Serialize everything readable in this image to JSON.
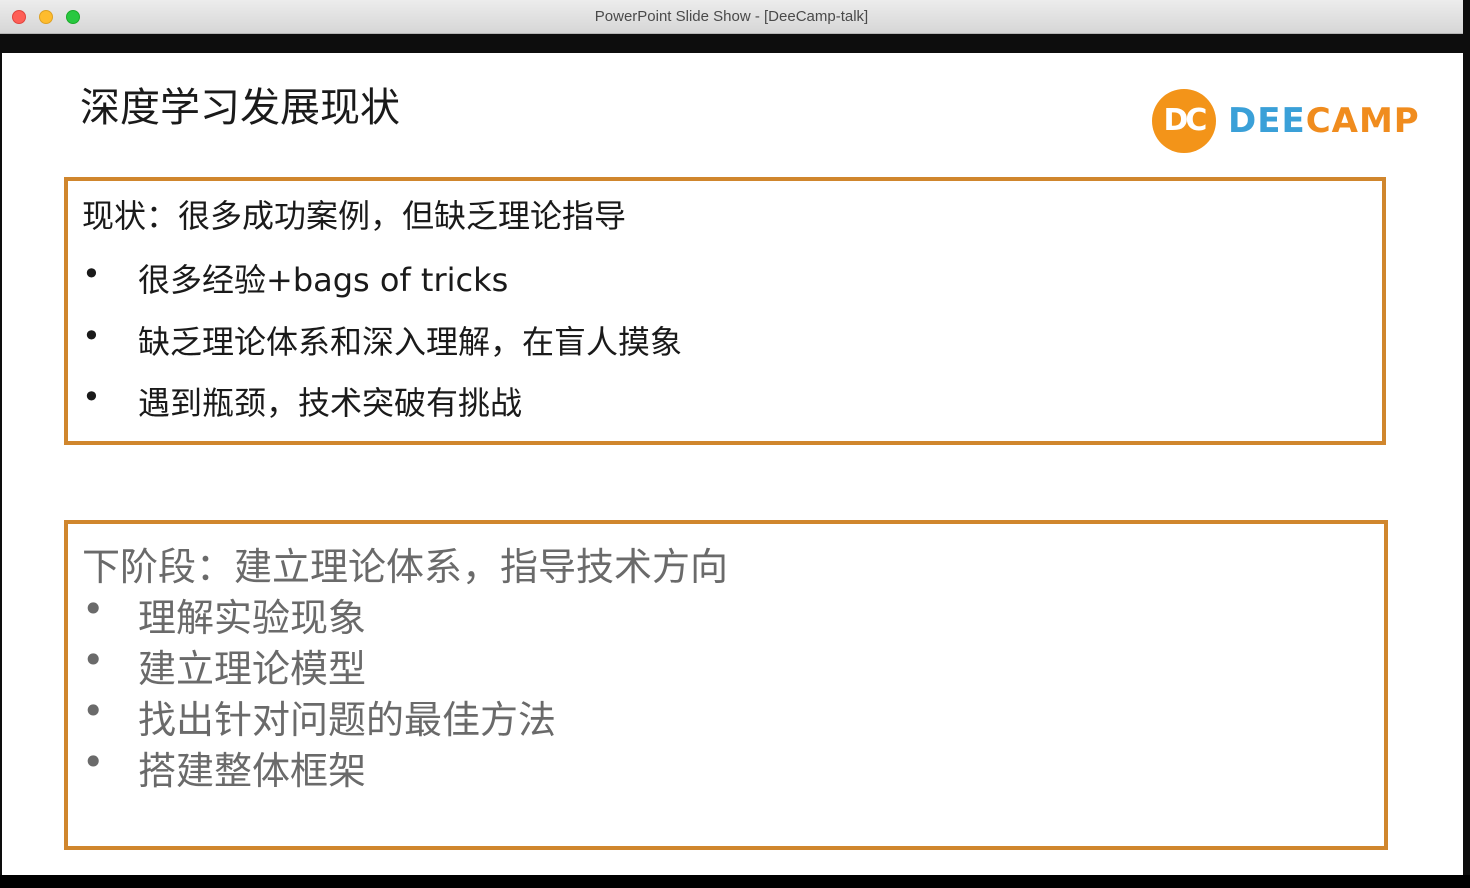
{
  "window": {
    "title": "PowerPoint Slide Show - [DeeCamp-talk]"
  },
  "slide": {
    "title": "深度学习发展现状",
    "logo": {
      "mark": "DC",
      "text_part1": "DEE",
      "text_part2": "CAMP",
      "colors": {
        "circle": "#f39419",
        "dee": "#3aa0d8",
        "camp": "#f08c1e"
      }
    },
    "current_box": {
      "heading": "现状：很多成功案例，但缺乏理论指导",
      "bullet": "•",
      "items": [
        "很多经验+bags of tricks",
        "缺乏理论体系和深入理解，在盲人摸象",
        "遇到瓶颈，技术突破有挑战"
      ]
    },
    "next_box": {
      "heading": "下阶段：建立理论体系，指导技术方向",
      "bullet": "•",
      "items": [
        "理解实验现象",
        "建立理论模型",
        "找出针对问题的最佳方法",
        "搭建整体框架"
      ]
    },
    "accent_color": "#d0862d"
  }
}
